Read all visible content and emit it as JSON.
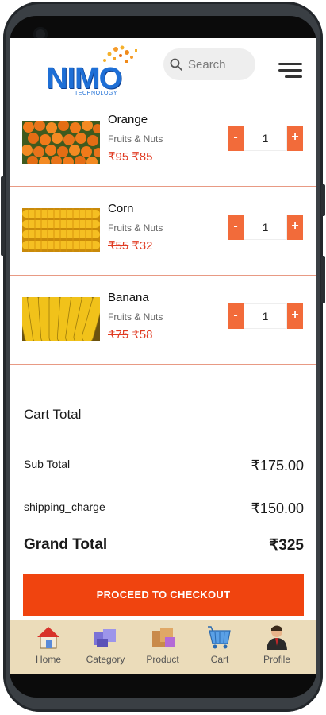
{
  "header": {
    "logo_text": "NIMO",
    "logo_subtext": "TECHNOLOGY",
    "search_placeholder": "Search"
  },
  "cart_items": [
    {
      "name": "Orange",
      "category": "Fruits & Nuts",
      "old_price": "₹95",
      "price": "₹85",
      "quantity": "1"
    },
    {
      "name": "Corn",
      "category": "Fruits & Nuts",
      "old_price": "₹55",
      "price": "₹32",
      "quantity": "1"
    },
    {
      "name": "Banana",
      "category": "Fruits & Nuts",
      "old_price": "₹75",
      "price": "₹58",
      "quantity": "1"
    }
  ],
  "qty_controls": {
    "minus": "-",
    "plus": "+"
  },
  "totals": {
    "title": "Cart Total",
    "subtotal_label": "Sub Total",
    "subtotal_value": "₹175.00",
    "shipping_label": "shipping_charge",
    "shipping_value": "₹150.00",
    "grand_label": "Grand Total",
    "grand_value": "₹325"
  },
  "checkout_label": "PROCEED TO CHECKOUT",
  "bottom_nav": [
    {
      "label": "Home",
      "icon": "home-icon"
    },
    {
      "label": "Category",
      "icon": "category-icon"
    },
    {
      "label": "Product",
      "icon": "product-icon"
    },
    {
      "label": "Cart",
      "icon": "cart-icon"
    },
    {
      "label": "Profile",
      "icon": "profile-icon"
    }
  ],
  "colors": {
    "accent": "#f0440f",
    "qty_button": "#f26b3a",
    "price": "#e03b22",
    "divider": "#e89a84",
    "nav_background": "#ebdcba"
  }
}
